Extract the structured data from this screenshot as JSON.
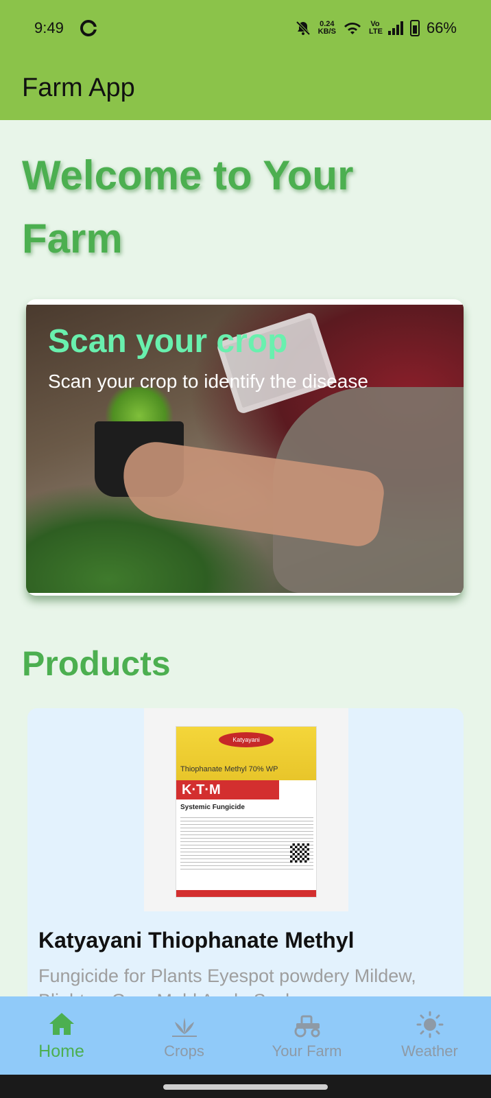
{
  "status_bar": {
    "time": "9:49",
    "net_speed_value": "0.24",
    "net_speed_unit": "KB/S",
    "lte_label": "Vo LTE",
    "battery": "66%"
  },
  "app_bar": {
    "title": "Farm App"
  },
  "welcome": {
    "text": "Welcome to Your Farm"
  },
  "scan_card": {
    "title": "Scan your crop",
    "subtitle": "Scan your crop to identify the disease"
  },
  "products": {
    "heading": "Products",
    "items": [
      {
        "title": "Katyayani Thiophanate Methyl",
        "description": "Fungicide for Plants Eyespot powdery Mildew, Blight or Gray Mold Apple Scab",
        "pack_brand": "Katyayani",
        "pack_name": "Thiophanate Methyl 70% WP",
        "pack_code": "K·T·M",
        "pack_type": "Systemic Fungicide"
      }
    ]
  },
  "bottom_nav": {
    "items": [
      {
        "label": "Home",
        "icon": "home-icon",
        "active": true
      },
      {
        "label": "Crops",
        "icon": "crops-icon",
        "active": false
      },
      {
        "label": "Your Farm",
        "icon": "tractor-icon",
        "active": false
      },
      {
        "label": "Weather",
        "icon": "sun-icon",
        "active": false
      }
    ]
  },
  "colors": {
    "app_bar": "#8BC34A",
    "background": "#E8F5E9",
    "accent_green": "#4CAF50",
    "scan_title": "#69F0AE",
    "product_card": "#E3F2FD",
    "bottom_nav": "#90CAF9",
    "inactive_nav": "#8E9AA6"
  }
}
